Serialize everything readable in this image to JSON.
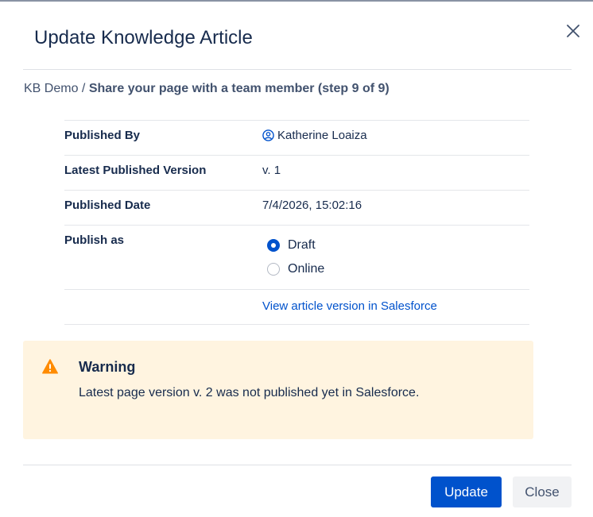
{
  "dialog": {
    "title": "Update Knowledge Article",
    "close_icon": "close-icon"
  },
  "breadcrumb": {
    "space": "KB Demo",
    "separator": "/",
    "current": "Share your page with a team member (step 9 of 9)"
  },
  "details": {
    "published_by": {
      "label": "Published By",
      "value": "Katherine Loaiza",
      "icon": "user-avatar-icon"
    },
    "latest_version": {
      "label": "Latest Published Version",
      "value": "v. 1"
    },
    "published_date": {
      "label": "Published Date",
      "value": "7/4/2026, 15:02:16"
    },
    "publish_as": {
      "label": "Publish as",
      "options": [
        {
          "label": "Draft",
          "checked": true
        },
        {
          "label": "Online",
          "checked": false
        }
      ]
    },
    "view_link": "View article version in Salesforce"
  },
  "warning": {
    "icon": "warning-icon",
    "color": "#fff4e0",
    "icon_color": "#ff8b00",
    "title": "Warning",
    "message": "Latest page version v. 2 was not published yet in Salesforce."
  },
  "footer": {
    "update_label": "Update",
    "close_label": "Close",
    "primary_color": "#0052cc"
  }
}
